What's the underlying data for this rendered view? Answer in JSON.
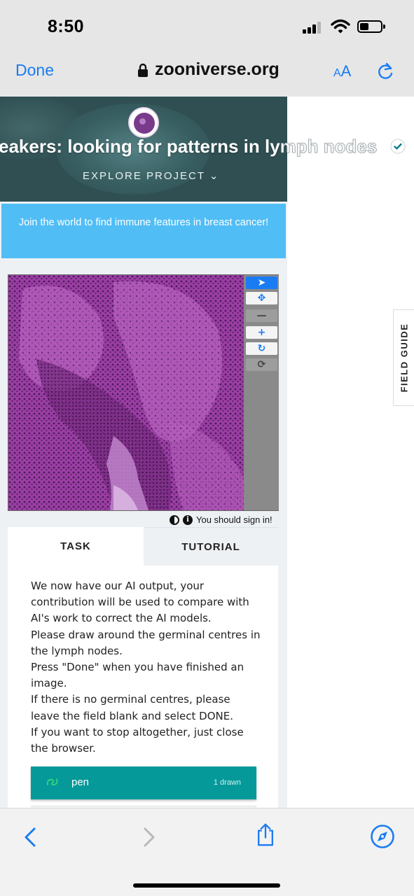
{
  "status_bar": {
    "time": "8:50"
  },
  "browser": {
    "done_label": "Done",
    "url": "zooniverse.org",
    "aa_small": "A",
    "aa_large": "A"
  },
  "project": {
    "title_part1": "eakers: looking for patterns in ly",
    "title_part2": "mph nodes",
    "explore_label": "EXPLORE PROJECT ⌄",
    "banner": "Join the world to find immune features in breast cancer!"
  },
  "viewer": {
    "tools": [
      "➤",
      "✥",
      "—",
      "+",
      "↻",
      "⟳"
    ]
  },
  "signin_notice": "You should sign in!",
  "tabs": {
    "task": "TASK",
    "tutorial": "TUTORIAL"
  },
  "task": {
    "instructions": [
      "We now have our AI output, your contribution will be used to compare with AI's work to correct the AI models.",
      "Please draw around the germinal centres in the lymph nodes.",
      "Press \"Done\" when you have finished an image.",
      "If there is no germinal centres, please leave the field blank and select DONE.",
      "If you want to stop altogether, just close the browser."
    ],
    "pen_tool": {
      "label": "pen",
      "count": "1 drawn",
      "color": "#33d17a"
    }
  },
  "field_guide": "FIELD GUIDE",
  "colors": {
    "ios_blue": "#1a7cf3",
    "banner": "#50bdf5",
    "tool_teal": "#05999a"
  }
}
